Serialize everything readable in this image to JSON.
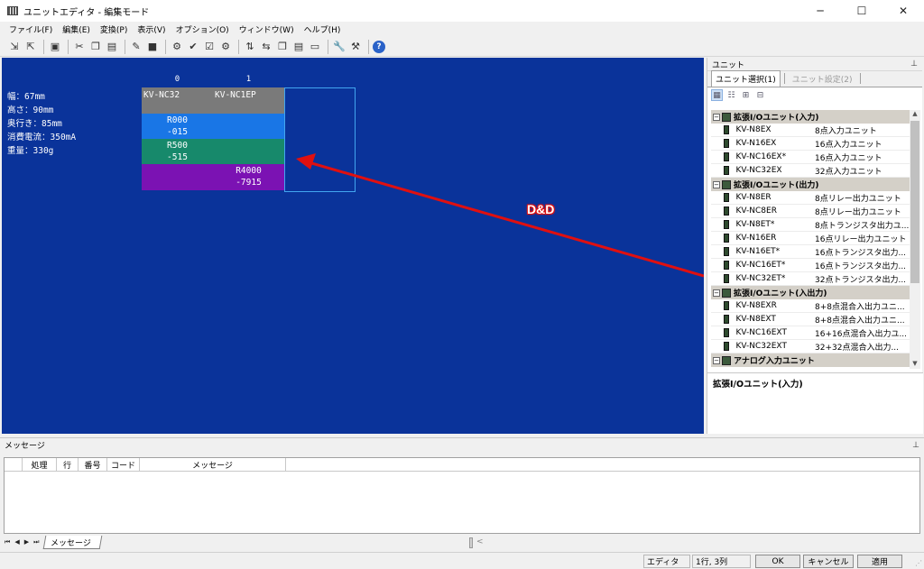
{
  "window": {
    "title": "ユニットエディタ - 編集モード",
    "minimize": "─",
    "maximize": "☐",
    "close": "✕"
  },
  "menu": [
    "ファイル(F)",
    "編集(E)",
    "変換(P)",
    "表示(V)",
    "オプション(O)",
    "ウィンドウ(W)",
    "ヘルプ(H)"
  ],
  "toolbar_icons": [
    "import-icon",
    "export-icon",
    "monitor-icon",
    "cut-icon",
    "copy-icon",
    "paste-icon",
    "edit-icon",
    "block-icon",
    "search-unit-icon",
    "check-icon",
    "verify-icon",
    "settings-icon",
    "transfer-icon",
    "transfer2-icon",
    "copy-unit-icon",
    "paste-unit-icon",
    "clear-icon",
    "wrench-icon",
    "tool-icon",
    "help-icon"
  ],
  "editor": {
    "specs": [
      "幅：67mm",
      "高さ：90mm",
      "奥行き：85mm",
      "消費電流：350mA",
      "重量：330g"
    ],
    "slots": [
      "0",
      "1"
    ],
    "units": [
      {
        "name": "KV-NC32",
        "blocks": [
          "",
          "R000\n-015",
          "R500\n-515",
          ""
        ]
      },
      {
        "name": "KV-NC1EP",
        "blocks": [
          "",
          "",
          "",
          "R4000\n-7915"
        ]
      }
    ],
    "annotation": "D&D"
  },
  "panel": {
    "title": "ユニット",
    "pin": "📌",
    "tabs": [
      "ユニット選択(1)",
      "ユニット設定(2)"
    ],
    "categories": [
      {
        "name": "拡張I/Oユニット(入力)",
        "items": [
          {
            "model": "KV-N8EX",
            "desc": "8点入力ユニット"
          },
          {
            "model": "KV-N16EX",
            "desc": "16点入力ユニット"
          },
          {
            "model": "KV-NC16EX*",
            "desc": "16点入力ユニット"
          },
          {
            "model": "KV-NC32EX",
            "desc": "32点入力ユニット"
          }
        ]
      },
      {
        "name": "拡張I/Oユニット(出力)",
        "items": [
          {
            "model": "KV-N8ER",
            "desc": "8点リレー出力ユニット"
          },
          {
            "model": "KV-NC8ER",
            "desc": "8点リレー出力ユニット"
          },
          {
            "model": "KV-N8ET*",
            "desc": "8点トランジスタ出力ユ..."
          },
          {
            "model": "KV-N16ER",
            "desc": "16点リレー出力ユニット"
          },
          {
            "model": "KV-N16ET*",
            "desc": "16点トランジスタ出力..."
          },
          {
            "model": "KV-NC16ET*",
            "desc": "16点トランジスタ出力..."
          },
          {
            "model": "KV-NC32ET*",
            "desc": "32点トランジスタ出力..."
          }
        ]
      },
      {
        "name": "拡張I/Oユニット(入出力)",
        "items": [
          {
            "model": "KV-N8EXR",
            "desc": "8+8点混合入出力ユニ..."
          },
          {
            "model": "KV-N8EXT",
            "desc": "8+8点混合入出力ユニ..."
          },
          {
            "model": "KV-NC16EXT",
            "desc": "16+16点混合入出力ユ..."
          },
          {
            "model": "KV-NC32EXT",
            "desc": "32+32点混合入出力..."
          }
        ]
      },
      {
        "name": "アナログ入力ユニット",
        "items": []
      }
    ],
    "description": "拡張I/Oユニット(入力)"
  },
  "messages": {
    "title": "メッセージ",
    "columns": [
      "処理",
      "行",
      "番号",
      "コード",
      "メッセージ"
    ],
    "tab": "メッセージ",
    "nav": [
      "⏮",
      "◀",
      "▶",
      "⏭"
    ]
  },
  "status": {
    "mode": "エディタ",
    "position": "1行, 3列",
    "ok": "OK",
    "cancel": "キャンセル",
    "apply": "適用"
  },
  "colors": {
    "editor_bg": "#0a339a",
    "input_block": "#1976e6",
    "output_block": "#17896b",
    "io_block": "#7b12b3",
    "arrow": "#e01010"
  }
}
